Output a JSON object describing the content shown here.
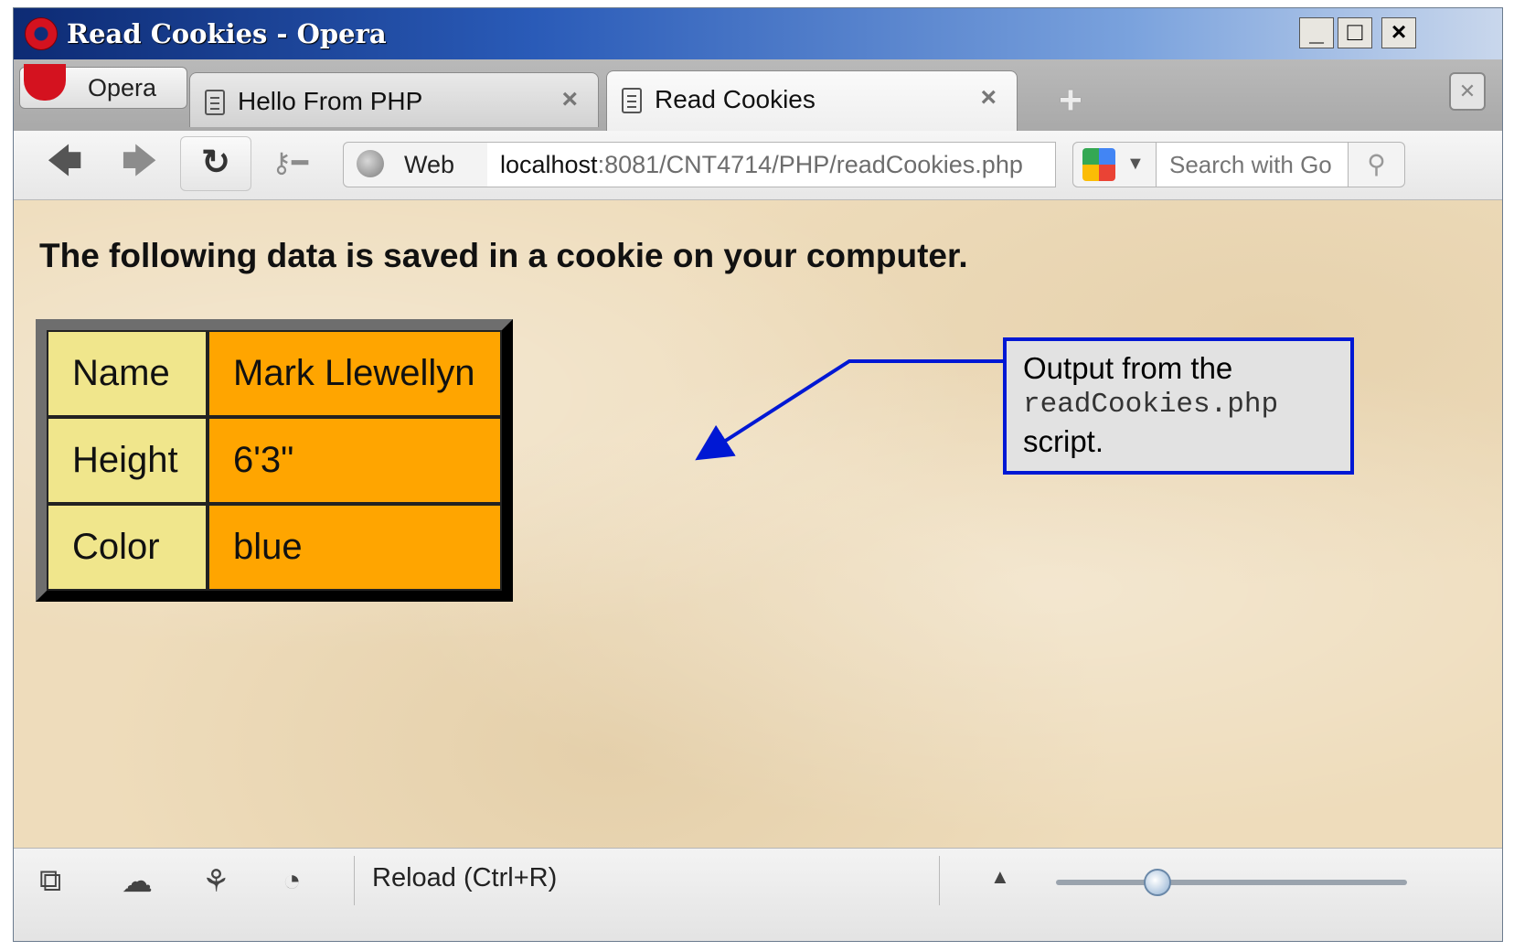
{
  "window": {
    "title": "Read Cookies - Opera",
    "controls": {
      "minimize": "_",
      "maximize": "□",
      "close": "×"
    }
  },
  "menu": {
    "label": "Opera"
  },
  "tabs": [
    {
      "label": "Hello From PHP",
      "active": false,
      "close": "×"
    },
    {
      "label": "Read Cookies",
      "active": true,
      "close": "×"
    }
  ],
  "toolbar": {
    "back_icon": "arrow-left-icon",
    "forward_icon": "arrow-right-icon",
    "reload_icon": "reload-icon",
    "web_label": "Web",
    "address_host": "localhost",
    "address_rest": ":8081/CNT4714/PHP/readCookies.php",
    "search_placeholder": "Search with Go"
  },
  "page": {
    "heading": "The following data is saved in a cookie on your computer.",
    "rows": [
      {
        "key": "Name",
        "value": "Mark Llewellyn"
      },
      {
        "key": "Height",
        "value": "6'3\""
      },
      {
        "key": "Color",
        "value": "blue"
      }
    ],
    "colors": {
      "key_cell": "#f0e68c",
      "value_cell": "#ffa500"
    }
  },
  "callout": {
    "line1": "Output from the",
    "line2": "readCookies.php",
    "line3": "script."
  },
  "status": {
    "text": "Reload (Ctrl+R)",
    "zoom_level": 0.29
  }
}
